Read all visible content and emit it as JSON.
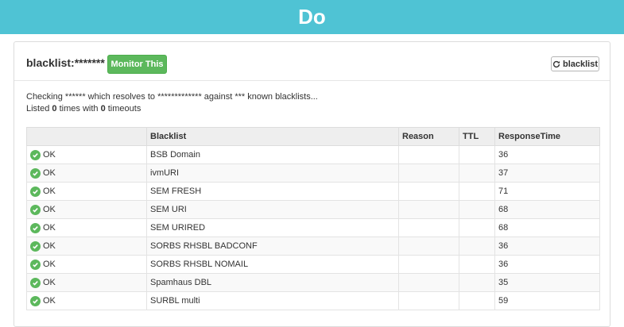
{
  "banner": {
    "title": "Do"
  },
  "panel": {
    "title": "blacklist:*******",
    "monitor_label": "Monitor This",
    "blacklist_button_label": "blacklist",
    "checking_text": "Checking ****** which resolves to ************* against *** known blacklists...",
    "listed_prefix": "Listed ",
    "listed_count": "0",
    "listed_mid": " times with ",
    "timeouts_count": "0",
    "listed_suffix": " timeouts"
  },
  "table": {
    "headers": [
      "",
      "Blacklist",
      "Reason",
      "TTL",
      "ResponseTime"
    ],
    "rows": [
      {
        "status": "OK",
        "blacklist": "BSB Domain",
        "reason": "",
        "ttl": "",
        "response": "36"
      },
      {
        "status": "OK",
        "blacklist": "ivmURI",
        "reason": "",
        "ttl": "",
        "response": "37"
      },
      {
        "status": "OK",
        "blacklist": "SEM FRESH",
        "reason": "",
        "ttl": "",
        "response": "71"
      },
      {
        "status": "OK",
        "blacklist": "SEM URI",
        "reason": "",
        "ttl": "",
        "response": "68"
      },
      {
        "status": "OK",
        "blacklist": "SEM URIRED",
        "reason": "",
        "ttl": "",
        "response": "68"
      },
      {
        "status": "OK",
        "blacklist": "SORBS RHSBL BADCONF",
        "reason": "",
        "ttl": "",
        "response": "36"
      },
      {
        "status": "OK",
        "blacklist": "SORBS RHSBL NOMAIL",
        "reason": "",
        "ttl": "",
        "response": "36"
      },
      {
        "status": "OK",
        "blacklist": "Spamhaus DBL",
        "reason": "",
        "ttl": "",
        "response": "35"
      },
      {
        "status": "OK",
        "blacklist": "SURBL multi",
        "reason": "",
        "ttl": "",
        "response": "59"
      }
    ]
  },
  "colors": {
    "banner": "#4fc3d4",
    "ok_green": "#5cb85c"
  }
}
